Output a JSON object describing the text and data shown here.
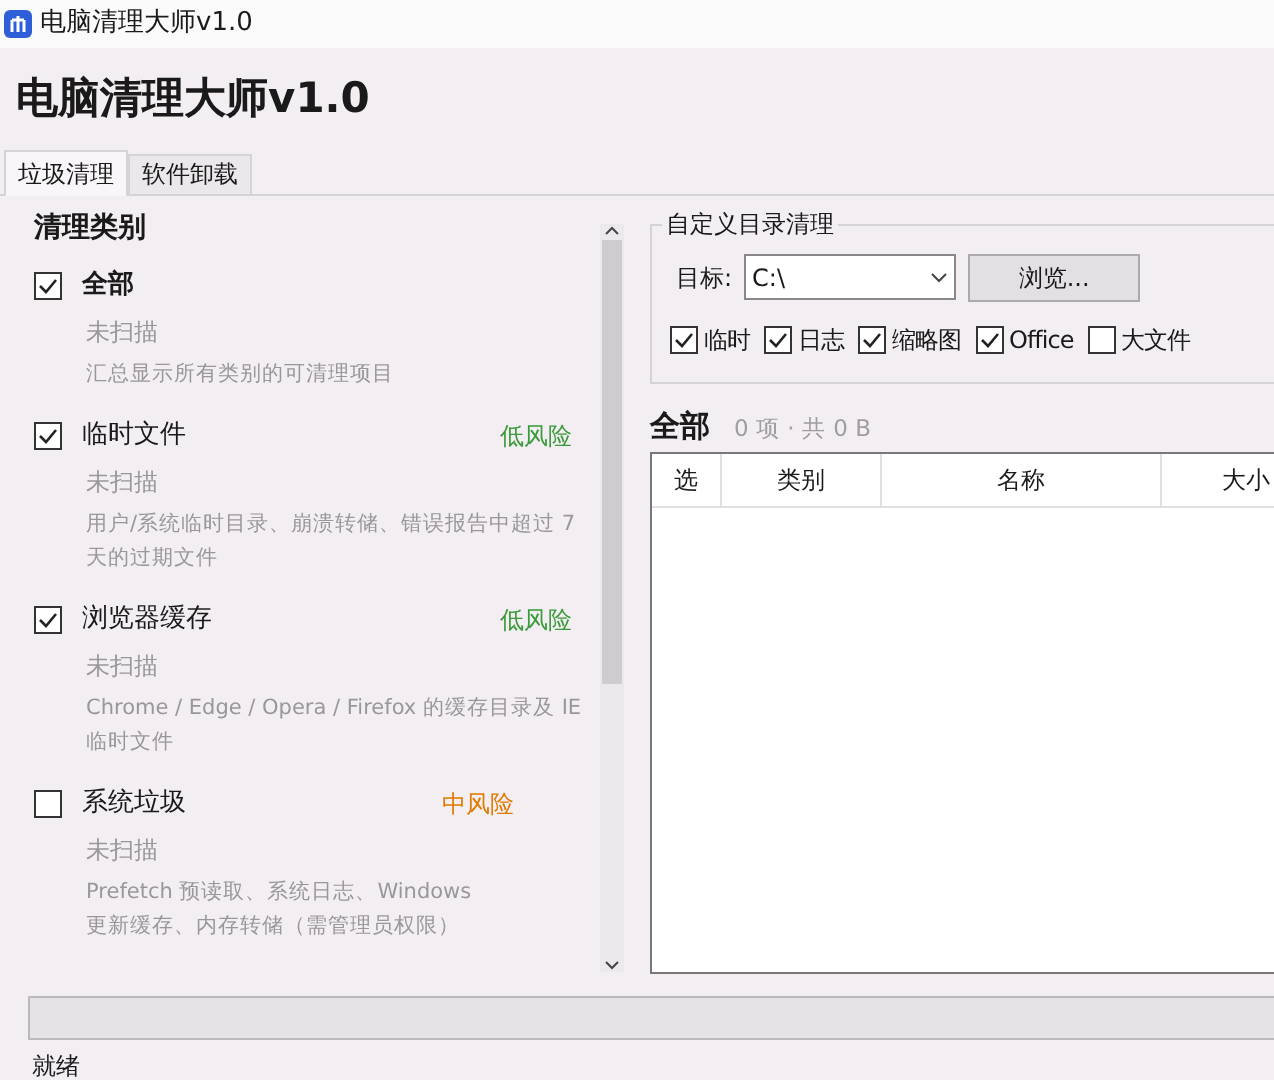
{
  "window": {
    "title": "电脑清理大师v1.0"
  },
  "heading": "电脑清理大师v1.0",
  "tabs": [
    {
      "label": "垃圾清理",
      "selected": true
    },
    {
      "label": "软件卸载",
      "selected": false
    }
  ],
  "categories": {
    "title": "清理类别",
    "items": [
      {
        "name": "全部",
        "checked": true,
        "status": "未扫描",
        "description": "汇总显示所有类别的可清理项目"
      },
      {
        "name": "临时文件",
        "checked": true,
        "risk": "低风险",
        "color": "#3a9a3a",
        "status": "未扫描",
        "description": "用户/系统临时目录、崩溃转储、错误报告中超过 7 天的过期文件"
      },
      {
        "name": "浏览器缓存",
        "checked": true,
        "risk": "低风险",
        "color": "#3a9a3a",
        "status": "未扫描",
        "description": "Chrome / Edge / Opera / Firefox 的缓存目录及 IE 临时文件"
      },
      {
        "name": "系统垃圾",
        "checked": false,
        "risk": "中风险",
        "color": "#e07b00",
        "status": "未扫描",
        "description": "Prefetch 预读取、系统日志、Windows 更新缓存、内存转储（需管理员权限）"
      }
    ]
  },
  "custom_dir": {
    "title": "自定义目录清理",
    "target_label": "目标:",
    "target_value": "C:\\",
    "browse_button": "浏览...",
    "options": [
      {
        "label": "临时",
        "checked": true
      },
      {
        "label": "日志",
        "checked": true
      },
      {
        "label": "缩略图",
        "checked": true
      },
      {
        "label": "Office",
        "checked": true
      },
      {
        "label": "大文件",
        "checked": false
      }
    ]
  },
  "results": {
    "title": "全部",
    "summary": "0 项 · 共 0 B",
    "columns": [
      "选",
      "类别",
      "名称",
      "大小"
    ]
  },
  "progress": {
    "level": 0
  },
  "status_bar": "就绪"
}
